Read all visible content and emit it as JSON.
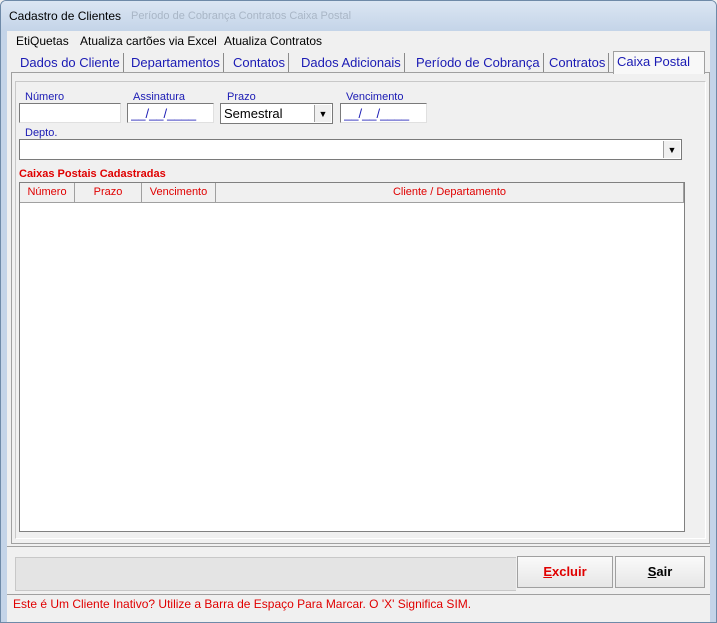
{
  "window": {
    "title": "Cadastro de Clientes",
    "ghost_text": "Período de Cobrança   Contratos   Caixa Postal"
  },
  "menu": {
    "items": [
      "EtiQuetas",
      "Atualiza cartões via Excel",
      "Atualiza Contratos"
    ]
  },
  "tabs": [
    {
      "label": "Dados do Cliente"
    },
    {
      "label": "Departamentos"
    },
    {
      "label": "Contatos"
    },
    {
      "label": "Dados Adicionais"
    },
    {
      "label": "Período de Cobrança"
    },
    {
      "label": "Contratos"
    },
    {
      "label": "Caixa Postal",
      "active": true
    }
  ],
  "form": {
    "numero_label": "Número",
    "numero_value": "",
    "assinatura_label": "Assinatura",
    "assinatura_value": "__/__/____",
    "prazo_label": "Prazo",
    "prazo_value": "Semestral",
    "vencimento_label": "Vencimento",
    "vencimento_value": "__/__/____",
    "depto_label": "Depto.",
    "depto_value": ""
  },
  "grid": {
    "title": "Caixas Postais Cadastradas",
    "columns": [
      "Número",
      "Prazo",
      "Vencimento",
      "Cliente / Departamento"
    ],
    "rows": []
  },
  "buttons": {
    "excluir_accel": "E",
    "excluir_rest": "xcluir",
    "sair_accel": "S",
    "sair_rest": "air"
  },
  "status_message": "Este é Um Cliente Inativo? Utilize a Barra de Espaço Para Marcar. O 'X' Significa SIM.",
  "colors": {
    "tab_text": "#1a1ab4",
    "label_blue": "#1a1ab4",
    "alert_red": "#e00000"
  },
  "icons": {
    "combo_arrow": "chevron-down-icon"
  }
}
